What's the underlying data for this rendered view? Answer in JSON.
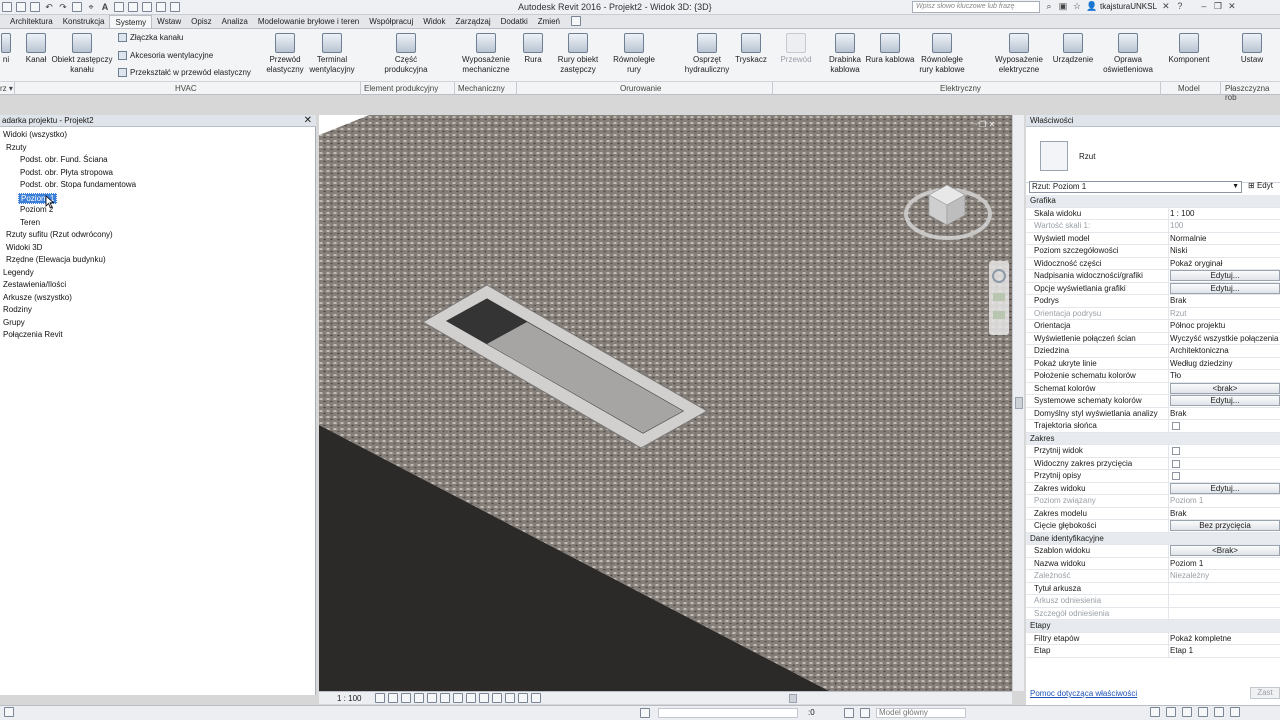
{
  "app": {
    "title": "Autodesk Revit 2016 -    Projekt2 - Widok 3D: {3D}",
    "search_placeholder": "Wpisz słowo kluczowe lub frazę",
    "user": "tkajsturaUNKSL"
  },
  "tabs": [
    "Architektura",
    "Konstrukcja",
    "Systemy",
    "Wstaw",
    "Opisz",
    "Analiza",
    "Modelowanie bryłowe i teren",
    "Współpracuj",
    "Widok",
    "Zarządzaj",
    "Dodatki",
    "Zmień"
  ],
  "active_tab": "Systemy",
  "ribbon": {
    "btn_trunc": "ni",
    "kanal": "Kanał",
    "obiekt_zastepczy_kanalu": "Obiekt zastępczy kanału",
    "zlaczka_kanalu": "Złączka kanału",
    "akcesoria_wentylacyjne": "Akcesoria wentylacyjne",
    "przeksztalc": "Przekształć w przewód elastyczny",
    "przewod_elastyczny": "Przewód elastyczny",
    "terminal_wentylacyjny": "Terminal wentylacyjny",
    "czesc_produkcyjna": "Część produkcyjna",
    "wyposazenie_mechaniczne": "Wyposażenie mechaniczne",
    "rura": "Rura",
    "rury_obiekt_zastepczy": "Rury obiekt zastępczy",
    "rownolegle_rury": "Równoległe rury",
    "osprzet_hydrauliczny": "Osprzęt hydrauliczny",
    "tryskacz": "Tryskacz",
    "przewod": "Przewód",
    "drabinka_kablowa": "Drabinka kablowa",
    "rura_kablowa": "Rura kablowa",
    "rownolegle_rury_kablowe": "Równoległe rury kablowe",
    "wyposazenie_elektryczne": "Wyposażenie elektryczne",
    "urzadzenie": "Urządzenie",
    "oprawa_oswietleniowa": "Oprawa oświetleniowa",
    "komponent": "Komponent",
    "ustaw": "Ustaw",
    "groups": {
      "g0": "rz ▾",
      "hvac": "HVAC",
      "element": "Element produkcyjny",
      "mechaniczny": "Mechaniczny",
      "orurowanie": "Orurowanie",
      "elektryczny": "Elektryczny",
      "model": "Model",
      "plaszczyzna": "Płaszczyzna rob"
    }
  },
  "browser": {
    "title": "adarka projektu - Projekt2",
    "items": [
      {
        "label": "Widoki (wszystko)"
      },
      {
        "label": "Rzuty"
      },
      {
        "label": "Podst. obr. Fund. Ściana"
      },
      {
        "label": "Podst. obr. Płyta stropowa"
      },
      {
        "label": "Podst. obr. Stopa fundamentowa"
      },
      {
        "label": "Poziom 1"
      },
      {
        "label": "Poziom 2"
      },
      {
        "label": "Teren"
      },
      {
        "label": "Rzuty sufitu (Rzut odwrócony)"
      },
      {
        "label": "Widoki 3D"
      },
      {
        "label": "Rzędne (Elewacja budynku)"
      },
      {
        "label": "Legendy"
      },
      {
        "label": "Zestawienia/Ilości"
      },
      {
        "label": "Arkusze (wszystko)"
      },
      {
        "label": "Rodziny"
      },
      {
        "label": "Grupy"
      },
      {
        "label": "Połączenia Revit"
      }
    ]
  },
  "view": {
    "scale": "1 : 100",
    "status_scale_hint": ":0"
  },
  "properties": {
    "title": "Właściwości",
    "type_name": "Rzut",
    "instance": "Rzut: Poziom 1",
    "edit_type": "Edyt",
    "help": "Pomoc dotycząca właściwości",
    "apply": "Zast",
    "rows": [
      {
        "k": "Grafika",
        "v": "",
        "cat": true
      },
      {
        "k": "Skala widoku",
        "v": "1 : 100"
      },
      {
        "k": "Wartość skali    1:",
        "v": "100",
        "grey": true
      },
      {
        "k": "Wyświetl model",
        "v": "Normalnie"
      },
      {
        "k": "Poziom szczegółowości",
        "v": "Niski"
      },
      {
        "k": "Widoczność części",
        "v": "Pokaż oryginał"
      },
      {
        "k": "Nadpisania widoczności/grafiki",
        "v": "Edytuj...",
        "btn": true
      },
      {
        "k": "Opcje wyświetlania grafiki",
        "v": "Edytuj...",
        "btn": true
      },
      {
        "k": "Podrys",
        "v": "Brak"
      },
      {
        "k": "Orientacja podrysu",
        "v": "Rzut",
        "grey": true
      },
      {
        "k": "Orientacja",
        "v": "Północ projektu"
      },
      {
        "k": "Wyświetlenie połączeń ścian",
        "v": "Wyczyść wszystkie połączenia"
      },
      {
        "k": "Dziedzina",
        "v": "Architektoniczna"
      },
      {
        "k": "Pokaż ukryte linie",
        "v": "Według dziedziny"
      },
      {
        "k": "Położenie schematu kolorów",
        "v": "Tło"
      },
      {
        "k": "Schemat kolorów",
        "v": "<brak>",
        "btn": true
      },
      {
        "k": "Systemowe schematy kolorów",
        "v": "Edytuj...",
        "btn": true
      },
      {
        "k": "Domyślny styl wyświetlania analizy",
        "v": "Brak"
      },
      {
        "k": "Trajektoria słońca",
        "v": "",
        "chk": true
      },
      {
        "k": "Zakres",
        "v": "",
        "cat": true
      },
      {
        "k": "Przytnij widok",
        "v": "",
        "chk": true
      },
      {
        "k": "Widoczny zakres przycięcia",
        "v": "",
        "chk": true
      },
      {
        "k": "Przytnij opisy",
        "v": "",
        "chk": true
      },
      {
        "k": "Zakres widoku",
        "v": "Edytuj...",
        "btn": true
      },
      {
        "k": "Poziom związany",
        "v": "Poziom 1",
        "grey": true
      },
      {
        "k": "Zakres modelu",
        "v": "Brak"
      },
      {
        "k": "Cięcie głębokości",
        "v": "Bez przycięcia",
        "btn": true
      },
      {
        "k": "Dane identyfikacyjne",
        "v": "",
        "cat": true
      },
      {
        "k": "Szablon widoku",
        "v": "<Brak>",
        "btn": true
      },
      {
        "k": "Nazwa widoku",
        "v": "Poziom 1"
      },
      {
        "k": "Zależność",
        "v": "Niezależny",
        "grey": true
      },
      {
        "k": "Tytuł arkusza",
        "v": ""
      },
      {
        "k": "Arkusz odniesienia",
        "v": "",
        "grey": true
      },
      {
        "k": "Szczegół odniesienia",
        "v": "",
        "grey": true
      },
      {
        "k": "Etapy",
        "v": "",
        "cat": true
      },
      {
        "k": "Filtry etapów",
        "v": "Pokaż kompletne"
      },
      {
        "k": "Etap",
        "v": "Etap 1"
      }
    ]
  },
  "status": {
    "zero": ":0",
    "model": "Model główny"
  }
}
